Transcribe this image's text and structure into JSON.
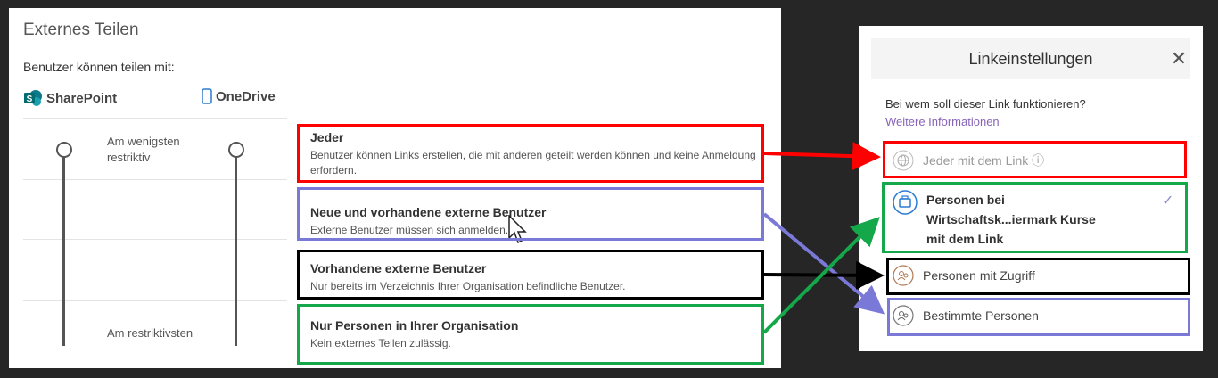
{
  "left_panel": {
    "title": "Externes Teilen",
    "subtitle": "Benutzer können teilen mit:",
    "platforms": {
      "sharepoint": "SharePoint",
      "onedrive": "OneDrive"
    },
    "least_label": "Am wenigsten restriktiv",
    "most_label": "Am restriktivsten",
    "options": [
      {
        "title": "Jeder",
        "desc": "Benutzer können Links erstellen, die mit anderen geteilt werden können und keine Anmeldung erfordern."
      },
      {
        "title": "Neue und vorhandene externe Benutzer",
        "desc": "Externe Benutzer müssen sich anmelden."
      },
      {
        "title": "Vorhandene externe Benutzer",
        "desc": "Nur bereits im Verzeichnis Ihrer Organisation befindliche Benutzer."
      },
      {
        "title": "Nur Personen in Ihrer Organisation",
        "desc": "Kein externes Teilen zulässig."
      }
    ]
  },
  "right_panel": {
    "title": "Linkeinstellungen",
    "close_glyph": "✕",
    "question": "Bei wem soll dieser Link funktionieren?",
    "more_info": "Weitere Informationen",
    "rows": [
      {
        "label": "Jeder mit dem Link ⓘ",
        "icon": "globe-icon"
      },
      {
        "label_line1": "Personen bei",
        "label_line2": "Wirtschaftsk...iermark Kurse",
        "label_line3": "mit dem Link",
        "icon": "organization-icon",
        "check": "✓"
      },
      {
        "label": "Personen mit Zugriff",
        "icon": "people-icon"
      },
      {
        "label": "Bestimmte Personen",
        "icon": "specific-people-icon"
      }
    ]
  },
  "colors": {
    "red": "#ff0000",
    "blue": "#7b79d8",
    "black": "#000000",
    "green": "#14a84a",
    "link_purple": "#8764b8",
    "background": "#262626"
  }
}
